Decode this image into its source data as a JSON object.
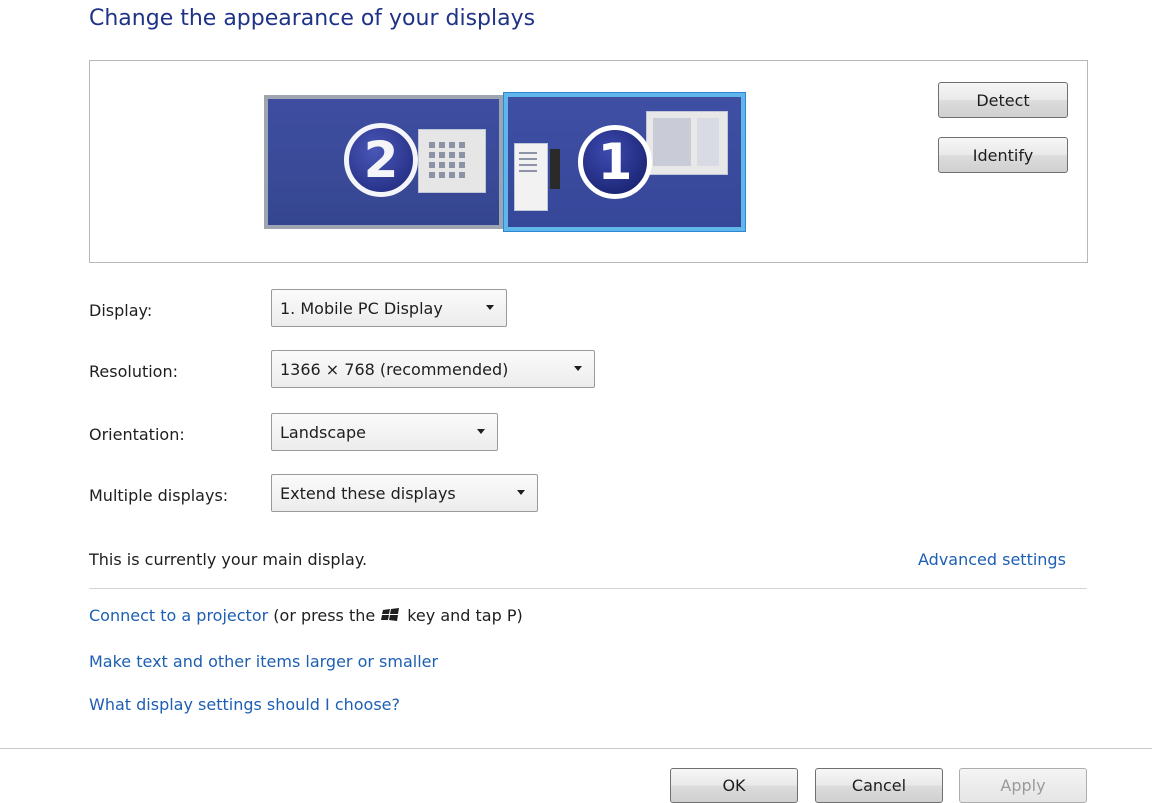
{
  "header": {
    "title": "Change the appearance of your displays"
  },
  "preview": {
    "monitors": [
      {
        "number": "2",
        "selected": false
      },
      {
        "number": "1",
        "selected": true
      }
    ]
  },
  "buttons": {
    "detect": "Detect",
    "identify": "Identify",
    "ok": "OK",
    "cancel": "Cancel",
    "apply": "Apply"
  },
  "fields": {
    "display": {
      "label": "Display:",
      "value": "1. Mobile PC Display"
    },
    "resolution": {
      "label": "Resolution:",
      "value": "1366 × 768 (recommended)"
    },
    "orientation": {
      "label": "Orientation:",
      "value": "Landscape"
    },
    "multiple": {
      "label": "Multiple displays:",
      "value": "Extend these displays"
    }
  },
  "status": {
    "main_display": "This is currently your main display."
  },
  "links": {
    "advanced": "Advanced settings",
    "projector": "Connect to a projector",
    "projector_hint_before": "(or press the",
    "projector_hint_after": "key and tap P)",
    "text_size": "Make text and other items larger or smaller",
    "help": "What display settings should I choose?"
  },
  "colors": {
    "title": "#1e3287",
    "link": "#1d5fb2",
    "selection": "#5fb6ea"
  }
}
